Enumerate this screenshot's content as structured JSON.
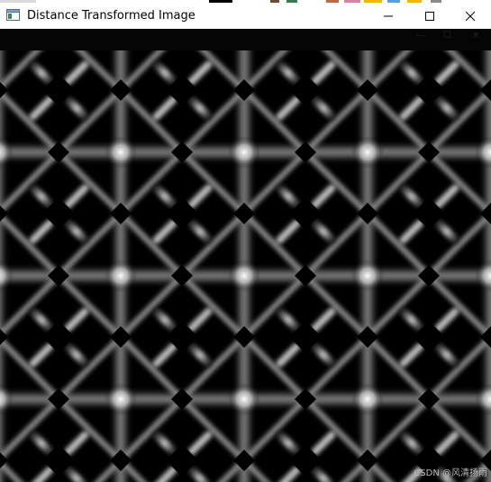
{
  "window": {
    "title": "Distance Transformed Image",
    "icon": "app-window-icon",
    "controls": {
      "minimize_icon": "minimize-icon",
      "maximize_icon": "maximize-icon",
      "close_icon": "close-icon"
    }
  },
  "image": {
    "description_icon": "distance-transform-pattern",
    "colors": {
      "background": "#000000",
      "bright": "#ffffff"
    }
  },
  "watermark": {
    "text": "CSDN @风清扬雨"
  }
}
